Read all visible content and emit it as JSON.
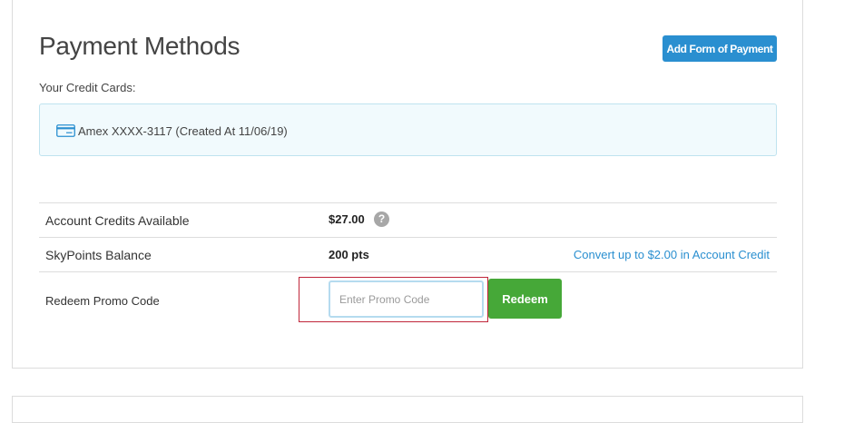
{
  "header": {
    "title": "Payment Methods",
    "add_payment_label": "Add Form of Payment"
  },
  "credit_cards": {
    "label": "Your Credit Cards:",
    "items": [
      {
        "text": "Amex XXXX-3117 (Created At 11/06/19)",
        "icon": "credit-card-icon"
      }
    ]
  },
  "account": {
    "credits_label": "Account Credits Available",
    "credits_value": "$27.00",
    "help_glyph": "?",
    "skypoints_label": "SkyPoints Balance",
    "skypoints_value": "200 pts",
    "convert_link": "Convert up to $2.00 in Account Credit"
  },
  "promo": {
    "label": "Redeem Promo Code",
    "placeholder": "Enter Promo Code",
    "value": "",
    "redeem_label": "Redeem"
  },
  "colors": {
    "primary_blue": "#2a8fd0",
    "redeem_green": "#46a838",
    "card_box_bg": "#f1fafd",
    "highlight_red": "#c0263a"
  }
}
